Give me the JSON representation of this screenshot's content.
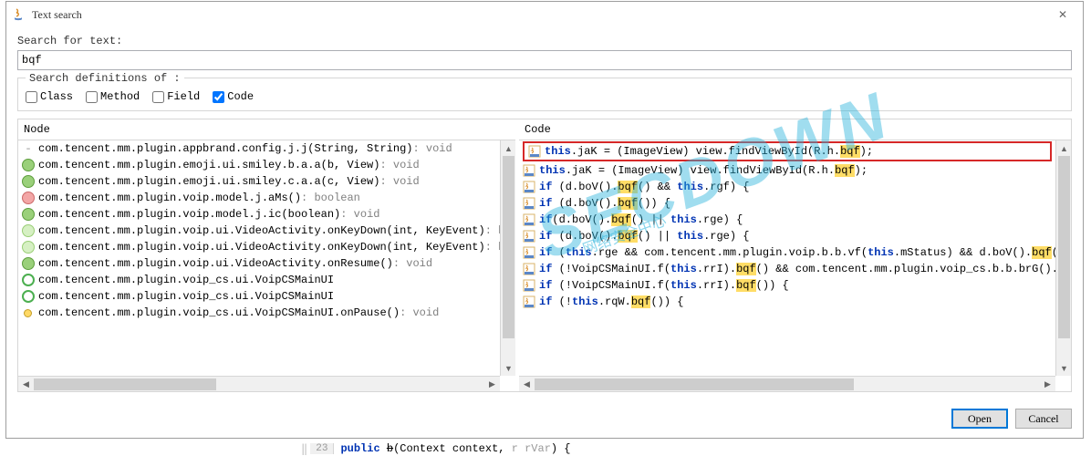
{
  "window": {
    "title": "Text search"
  },
  "search": {
    "label": "Search for text:",
    "value": "bqf"
  },
  "defs": {
    "legend": "Search definitions of :",
    "class": "Class",
    "class_checked": false,
    "method": "Method",
    "method_checked": false,
    "field": "Field",
    "field_checked": false,
    "code": "Code",
    "code_checked": true
  },
  "headers": {
    "node": "Node",
    "code": "Code"
  },
  "nodes": [
    {
      "icon": "dash",
      "sig": "com.tencent.mm.plugin.appbrand.config.j.j(String, String)",
      "ret": " : void"
    },
    {
      "icon": "method",
      "sig": "com.tencent.mm.plugin.emoji.ui.smiley.b.a.a(b, View)",
      "ret": " : void"
    },
    {
      "icon": "method",
      "sig": "com.tencent.mm.plugin.emoji.ui.smiley.c.a.a(c, View)",
      "ret": " : void"
    },
    {
      "icon": "field",
      "sig": "com.tencent.mm.plugin.voip.model.j.aMs()",
      "ret": " : boolean"
    },
    {
      "icon": "method",
      "sig": "com.tencent.mm.plugin.voip.model.j.ic(boolean)",
      "ret": " : void"
    },
    {
      "icon": "method2",
      "sig": "com.tencent.mm.plugin.voip.ui.VideoActivity.onKeyDown(int, KeyEvent)",
      "ret": " : boolean"
    },
    {
      "icon": "method2",
      "sig": "com.tencent.mm.plugin.voip.ui.VideoActivity.onKeyDown(int, KeyEvent)",
      "ret": " : boolean"
    },
    {
      "icon": "method",
      "sig": "com.tencent.mm.plugin.voip.ui.VideoActivity.onResume()",
      "ret": " : void"
    },
    {
      "icon": "circle-green",
      "sig": "com.tencent.mm.plugin.voip_cs.ui.VoipCSMainUI",
      "ret": ""
    },
    {
      "icon": "circle-green",
      "sig": "com.tencent.mm.plugin.voip_cs.ui.VoipCSMainUI",
      "ret": ""
    },
    {
      "icon": "diamond",
      "sig": "com.tencent.mm.plugin.voip_cs.ui.VoipCSMainUI.onPause()",
      "ret": " : void"
    }
  ],
  "code_lines": [
    {
      "boxed": true,
      "tokens": [
        {
          "t": "this",
          "c": "kw"
        },
        {
          "t": ".jaK = (ImageView) view.findViewById(R.h."
        },
        {
          "t": "bqf",
          "c": "hl"
        },
        {
          "t": ");"
        }
      ]
    },
    {
      "tokens": [
        {
          "t": "this",
          "c": "kw"
        },
        {
          "t": ".jaK = (ImageView) view.findViewById(R.h."
        },
        {
          "t": "bqf",
          "c": "hl"
        },
        {
          "t": ");"
        }
      ]
    },
    {
      "tokens": [
        {
          "t": "if",
          "c": "kw"
        },
        {
          "t": " (d.boV()."
        },
        {
          "t": "bqf",
          "c": "hl"
        },
        {
          "t": "() && "
        },
        {
          "t": "this",
          "c": "kw"
        },
        {
          "t": ".rgf) {"
        }
      ]
    },
    {
      "tokens": [
        {
          "t": "if",
          "c": "kw"
        },
        {
          "t": " (d.boV()."
        },
        {
          "t": "bqf",
          "c": "hl"
        },
        {
          "t": "()) {"
        }
      ]
    },
    {
      "tokens": [
        {
          "t": "if",
          "c": "kw"
        },
        {
          "t": "(d.boV()."
        },
        {
          "t": "bqf",
          "c": "hl"
        },
        {
          "t": "() || "
        },
        {
          "t": "this",
          "c": "kw"
        },
        {
          "t": ".rge) {"
        }
      ]
    },
    {
      "tokens": [
        {
          "t": "if",
          "c": "kw"
        },
        {
          "t": " (d.boV()."
        },
        {
          "t": "bqf",
          "c": "hl"
        },
        {
          "t": "() || "
        },
        {
          "t": "this",
          "c": "kw"
        },
        {
          "t": ".rge) {"
        }
      ]
    },
    {
      "tokens": [
        {
          "t": "if",
          "c": "kw"
        },
        {
          "t": " ("
        },
        {
          "t": "this",
          "c": "kw"
        },
        {
          "t": ".rge && com.tencent.mm.plugin.voip.b.b.vf("
        },
        {
          "t": "this",
          "c": "kw"
        },
        {
          "t": ".mStatus) && d.boV()."
        },
        {
          "t": "bqf",
          "c": "hl"
        },
        {
          "t": "()) {"
        }
      ]
    },
    {
      "tokens": [
        {
          "t": "if",
          "c": "kw"
        },
        {
          "t": " (!VoipCSMainUI.f("
        },
        {
          "t": "this",
          "c": "kw"
        },
        {
          "t": ".rrI)."
        },
        {
          "t": "bqf",
          "c": "hl"
        },
        {
          "t": "() && com.tencent.mm.plugin.voip_cs.b.b.brG().rqQ"
        }
      ]
    },
    {
      "tokens": [
        {
          "t": "if",
          "c": "kw"
        },
        {
          "t": " (!VoipCSMainUI.f("
        },
        {
          "t": "this",
          "c": "kw"
        },
        {
          "t": ".rrI)."
        },
        {
          "t": "bqf",
          "c": "hl"
        },
        {
          "t": "()) {"
        }
      ]
    },
    {
      "tokens": [
        {
          "t": "if",
          "c": "kw"
        },
        {
          "t": " (!"
        },
        {
          "t": "this",
          "c": "kw"
        },
        {
          "t": ".rqW."
        },
        {
          "t": "bqf",
          "c": "hl"
        },
        {
          "t": "()) {"
        }
      ]
    }
  ],
  "buttons": {
    "open": "Open",
    "cancel": "Cancel"
  },
  "bottom_strip": {
    "line_num": "23",
    "tokens_html": "<span class='kw'>public</span> <span class='strike'>b</span>(Context context, <span style='color:#999'>r rVar</span>) {"
  },
  "watermark": {
    "main": "SECDOWN",
    "sub": "网络安全中心"
  }
}
